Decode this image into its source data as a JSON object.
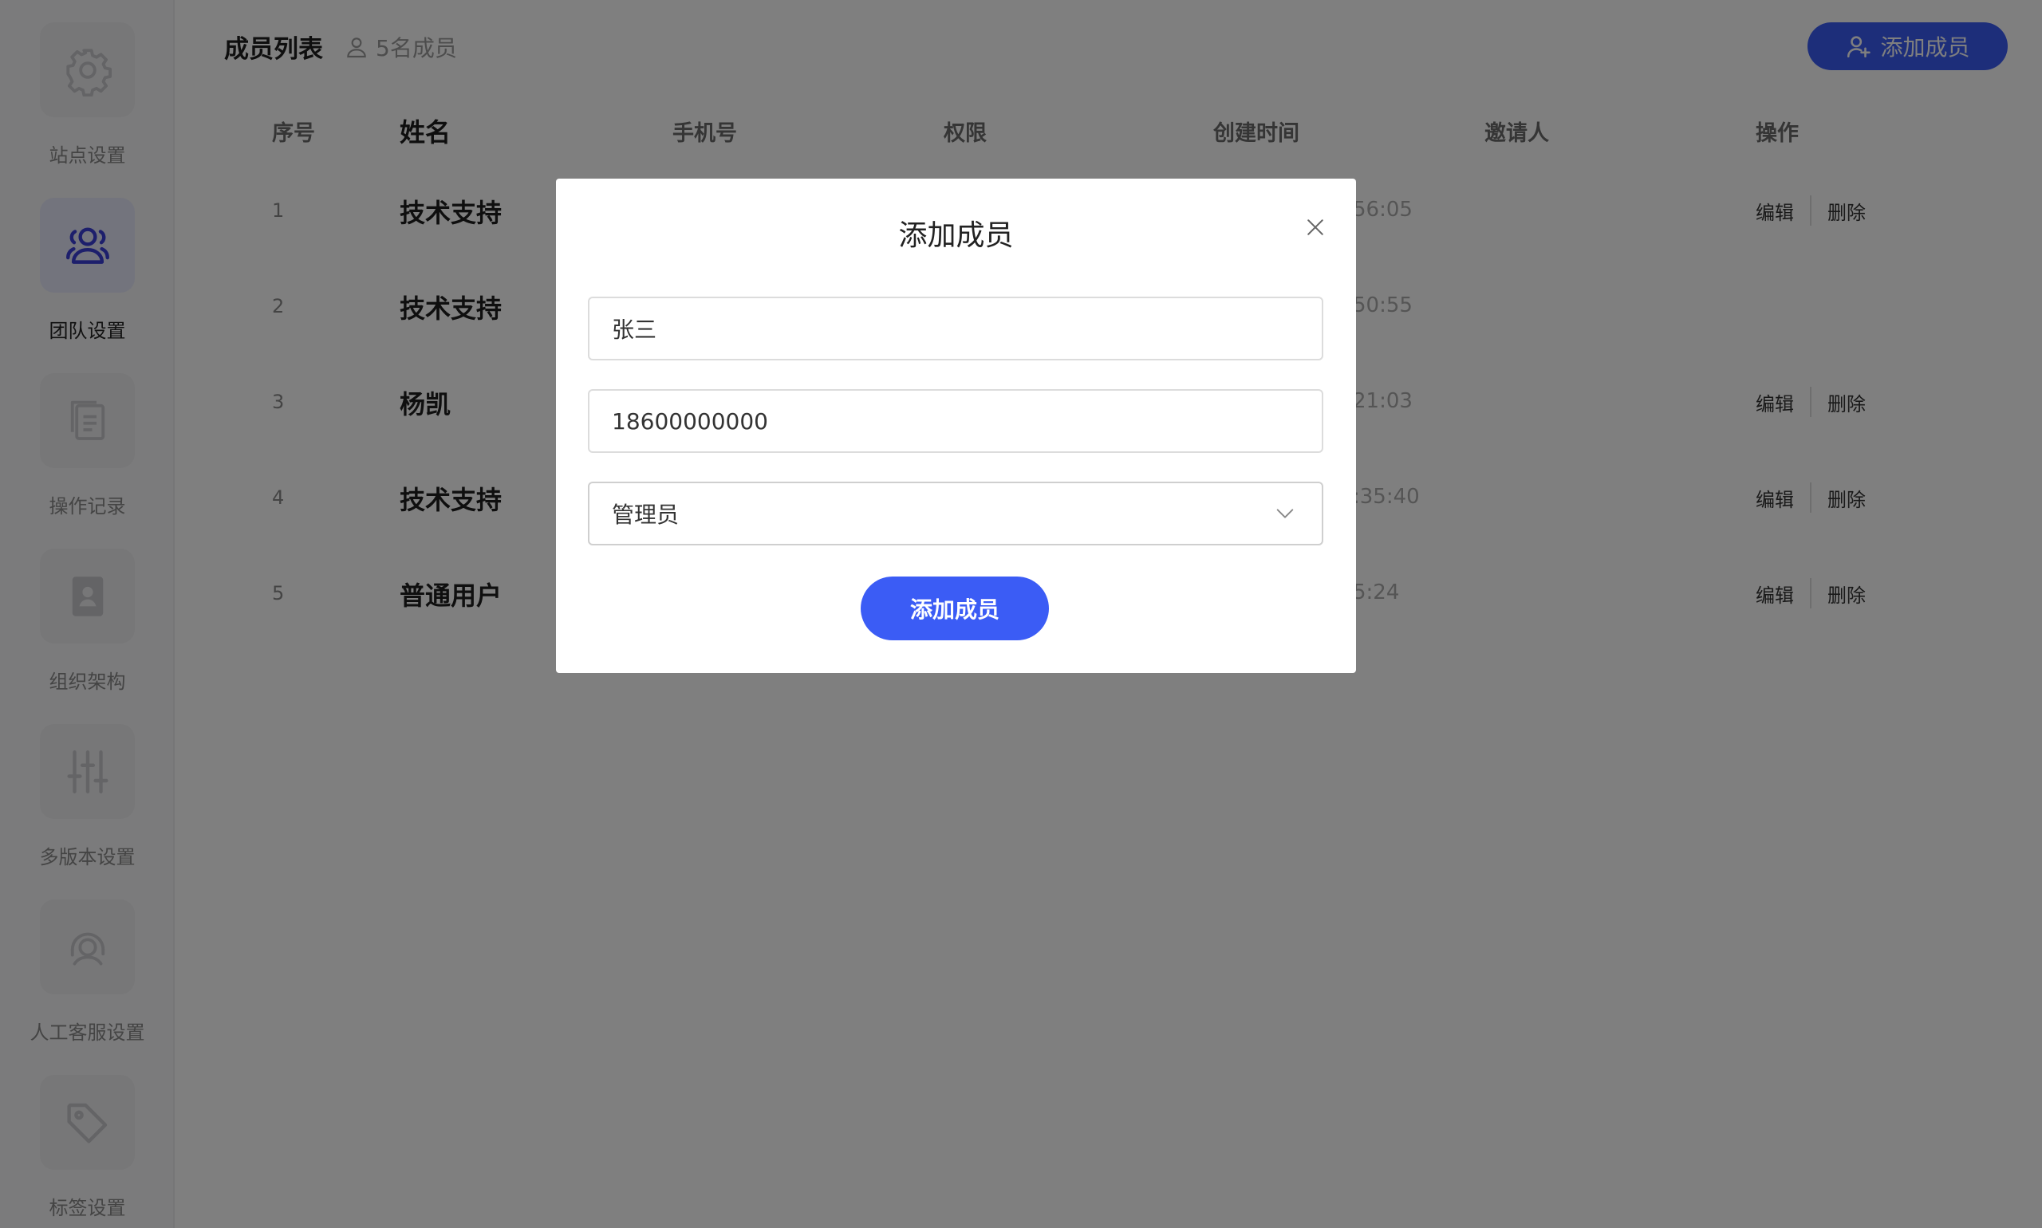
{
  "sidebar": {
    "items": [
      {
        "label": "站点设置",
        "icon": "gear-icon",
        "active": false
      },
      {
        "label": "团队设置",
        "icon": "team-icon",
        "active": true
      },
      {
        "label": "操作记录",
        "icon": "document-icon",
        "active": false
      },
      {
        "label": "组织架构",
        "icon": "contact-book-icon",
        "active": false
      },
      {
        "label": "多版本设置",
        "icon": "sliders-icon",
        "active": false
      },
      {
        "label": "人工客服设置",
        "icon": "customer-service-icon",
        "active": false
      },
      {
        "label": "标签设置",
        "icon": "tag-icon",
        "active": false
      }
    ]
  },
  "header": {
    "title": "成员列表",
    "member_count": "5名成员",
    "add_button": "添加成员"
  },
  "table": {
    "columns": [
      "序号",
      "姓名",
      "手机号",
      "权限",
      "创建时间",
      "邀请人",
      "操作"
    ],
    "rows": [
      {
        "index": "1",
        "name": "技术支持",
        "time_fragment": "56:05",
        "edit": "编辑",
        "delete": "删除",
        "has_ops": true
      },
      {
        "index": "2",
        "name": "技术支持",
        "time_fragment": "50:55",
        "edit": "",
        "delete": "",
        "has_ops": false
      },
      {
        "index": "3",
        "name": "杨凯",
        "time_fragment": "21:03",
        "edit": "编辑",
        "delete": "删除",
        "has_ops": true
      },
      {
        "index": "4",
        "name": "技术支持",
        "time_fragment": ":35:40",
        "edit": "编辑",
        "delete": "删除",
        "has_ops": true
      },
      {
        "index": "5",
        "name": "普通用户",
        "time_fragment": "5:24",
        "edit": "编辑",
        "delete": "删除",
        "has_ops": true
      }
    ]
  },
  "modal": {
    "title": "添加成员",
    "name_value": "张三",
    "phone_value": "18600000000",
    "role_value": "管理员",
    "submit": "添加成员"
  },
  "colors": {
    "accent": "#3b5cf5",
    "overlay": "rgba(0,0,0,0.5)",
    "active_icon": "#3b3fd8"
  }
}
